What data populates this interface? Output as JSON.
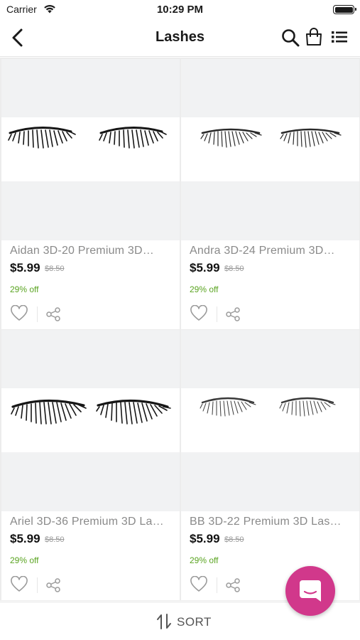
{
  "status_bar": {
    "carrier": "Carrier",
    "time": "10:29 PM"
  },
  "nav": {
    "title": "Lashes",
    "icons": [
      "chevron-left-icon",
      "search-icon",
      "shopping-bag-icon",
      "list-icon"
    ]
  },
  "products": [
    {
      "name": "Aidan  3D-20 Premium 3D…",
      "price": "$5.99",
      "old_price": "$8.50",
      "discount": "29% off"
    },
    {
      "name": "Andra 3D-24 Premium 3D…",
      "price": "$5.99",
      "old_price": "$8.50",
      "discount": "29% off"
    },
    {
      "name": "Ariel 3D-36 Premium 3D La…",
      "price": "$5.99",
      "old_price": "$8.50",
      "discount": "29% off"
    },
    {
      "name": "BB 3D-22 Premium 3D Las…",
      "price": "$5.99",
      "old_price": "$8.50",
      "discount": "29% off"
    }
  ],
  "sort": {
    "label": "SORT"
  },
  "colors": {
    "accent": "#d1388b",
    "discount": "#5aa421",
    "background": "#ececec"
  }
}
